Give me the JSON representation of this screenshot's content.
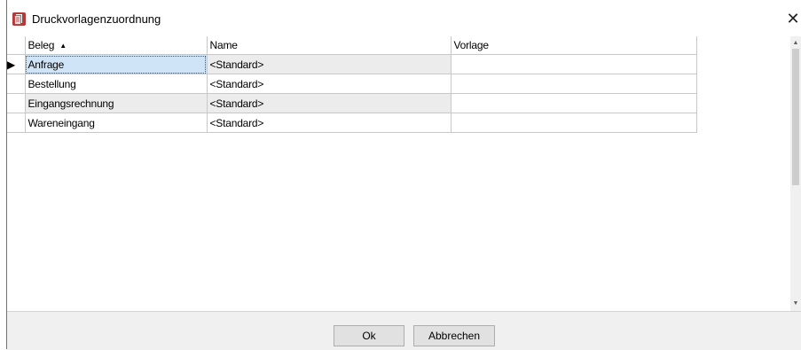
{
  "window": {
    "title": "Druckvorlagenzuordnung",
    "close_glyph": "✕"
  },
  "grid": {
    "columns": [
      {
        "label": "Beleg",
        "sorted": "ascending",
        "sort_glyph": "▲"
      },
      {
        "label": "Name"
      },
      {
        "label": "Vorlage"
      }
    ],
    "current_row_glyph": "▶",
    "rows": [
      {
        "beleg": "Anfrage",
        "name": "<Standard>",
        "vorlage": ""
      },
      {
        "beleg": "Bestellung",
        "name": "<Standard>",
        "vorlage": ""
      },
      {
        "beleg": "Eingangsrechnung",
        "name": "<Standard>",
        "vorlage": ""
      },
      {
        "beleg": "Wareneingang",
        "name": "<Standard>",
        "vorlage": ""
      }
    ],
    "selected_row": 0
  },
  "scrollbar": {
    "up_glyph": "▲",
    "down_glyph": "▼"
  },
  "buttons": {
    "ok_label": "Ok",
    "cancel_label": "Abbrechen"
  },
  "colors": {
    "selection": "#cfe5f7",
    "alt_row": "#ececec",
    "sort_underline": "#e0843c",
    "app_icon": "#b43a3a"
  }
}
